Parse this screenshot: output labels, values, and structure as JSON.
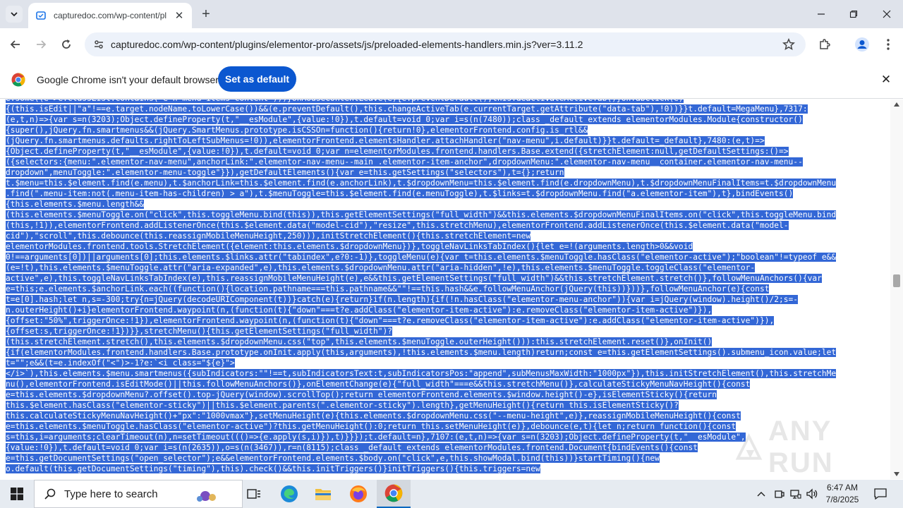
{
  "browser": {
    "tab_title": "capturedoc.com/wp-content/pl",
    "url": "capturedoc.com/wp-content/plugins/elementor-pro/assets/js/preloaded-elements-handlers.min.js?ver=3.11.2",
    "infobar_text": "Google Chrome isn't your default browser",
    "set_default_label": "Set as default"
  },
  "code_lines": [
    "e.some((e=>e.classList.contains(\"e-n-menu-items-content\")))}onMouseContentLeave(e){e.preventDefault(),this.deactivateActiveTab()}onTabClick(e)",
    "{(this.isEdit||\"a\"!==e.target.nodeName.toLowerCase())&&(e.preventDefault(),this.changeActiveTab(e.currentTarget.getAttribute(\"data-tab\"),!0))}}t.default=MegaMenu},7317:",
    "(e,t,n)=>{var s=n(3203);Object.defineProperty(t,\"__esModule\",{value:!0}),t.default=void 0;var i=s(n(7480));class _default extends elementorModules.Module{constructor()",
    "{super(),jQuery.fn.smartmenus&&(jQuery.SmartMenus.prototype.isCSSOn=function(){return!0},elementorFrontend.config.is_rtl&&",
    "(jQuery.fn.smartmenus.defaults.rightToLeftSubMenus=!0)),elementorFrontend.elementsHandler.attachHandler(\"nav-menu\",i.default)}}t.default=_default},7480:(e,t)=>",
    "{Object.defineProperty(t,\"__esModule\",{value:!0}),t.default=void 0;var n=elementorModules.frontend.handlers.Base.extend({stretchElement:null,getDefaultSettings:()=>",
    "({selectors:{menu:\".elementor-nav-menu\",anchorLink:\".elementor-nav-menu--main .elementor-item-anchor\",dropdownMenu:\".elementor-nav-menu__container.elementor-nav-menu--",
    "dropdown\",menuToggle:\".elementor-menu-toggle\"}}),getDefaultElements(){var e=this.getSettings(\"selectors\"),t={};return",
    "t.$menu=this.$element.find(e.menu),t.$anchorLink=this.$element.find(e.anchorLink),t.$dropdownMenu=this.$element.find(e.dropdownMenu),t.$dropdownMenuFinalItems=t.$dropdownMenu",
    ".find(\".menu-item:not(.menu-item-has-children) > a\"),t.$menuToggle=this.$element.find(e.menuToggle),t.$links=t.$dropdownMenu.find(\"a.elementor-item\"),t},bindEvents()",
    "{this.elements.$menu.length&&",
    "(this.elements.$menuToggle.on(\"click\",this.toggleMenu.bind(this)),this.getElementSettings(\"full_width\")&&this.elements.$dropdownMenuFinalItems.on(\"click\",this.toggleMenu.bind",
    "(this,!1)),elementorFrontend.addListenerOnce(this.$element.data(\"model-cid\"),\"resize\",this.stretchMenu),elementorFrontend.addListenerOnce(this.$element.data(\"model-",
    "cid\"),\"scroll\",this.debounce(this.reassignMobileMenuHeight,250))),initStretchElement(){this.stretchElement=new",
    "elementorModules.frontend.tools.StretchElement({element:this.elements.$dropdownMenu})},toggleNavLinksTabIndex(){let e=!(arguments.length>0&&void",
    "0!==arguments[0])||arguments[0];this.elements.$links.attr(\"tabindex\",e?0:-1)},toggleMenu(e){var t=this.elements.$menuToggle.hasClass(\"elementor-active\");\"boolean\"!=typeof e&&",
    "(e=!t),this.elements.$menuToggle.attr(\"aria-expanded\",e),this.elements.$dropdownMenu.attr(\"aria-hidden\",!e),this.elements.$menuToggle.toggleClass(\"elementor-",
    "active\",e),this.toggleNavLinksTabIndex(e),this.reassignMobileMenuHeight(e),e&&this.getElementSettings(\"full_width\")&&this.stretchElement.stretch()},followMenuAnchors(){var",
    "e=this;e.elements.$anchorLink.each((function(){location.pathname===this.pathname&&\"\"!==this.hash&&e.followMenuAnchor(jQuery(this))}))},followMenuAnchor(e){const",
    "t=e[0].hash;let n,s=-300;try{n=jQuery(decodeURIComponent(t))}catch(e){return}if(n.length){if(!n.hasClass(\"elementor-menu-anchor\")){var i=jQuery(window).height()/2;s=-",
    "n.outerHeight()+i}elementorFrontend.waypoint(n,(function(t){\"down\"===t?e.addClass(\"elementor-item-active\"):e.removeClass(\"elementor-item-active\")}),",
    "{offset:\"50%\",triggerOnce:!1}),elementorFrontend.waypoint(n,(function(t){\"down\"===t?e.removeClass(\"elementor-item-active\"):e.addClass(\"elementor-item-active\")}),",
    "{offset:s,triggerOnce:!1})}},stretchMenu(){this.getElementSettings(\"full_width\")?",
    "(this.stretchElement.stretch(),this.elements.$dropdownMenu.css(\"top\",this.elements.$menuToggle.outerHeight())):this.stretchElement.reset()},onInit()",
    "{if(elementorModules.frontend.handlers.Base.prototype.onInit.apply(this,arguments),!this.elements.$menu.length)return;const e=this.getElementSettings().submenu_icon.value;let",
    "t=\"\";e&&(t=e.indexOf(\"<\")>-1?e:`<i class=\"${e}\">",
    "</i>`),this.elements.$menu.smartmenus({subIndicators:\"\"!==t,subIndicatorsText:t,subIndicatorsPos:\"append\",subMenusMaxWidth:\"1000px\"}),this.initStretchElement(),this.stretchMe",
    "nu(),elementorFrontend.isEditMode()||this.followMenuAnchors()},onElementChange(e){\"full_width\"===e&&this.stretchMenu()},calculateStickyMenuNavHeight(){const",
    "e=this.elements.$dropdownMenu?.offset().top-jQuery(window).scrollTop();return elementorFrontend.elements.$window.height()-e},isElementSticky(){return",
    "this.$element.hasClass(\"elementor-sticky\")||this.$element.parents(\".elementor-sticky\").length},getMenuHeight(){return this.isElementSticky()?",
    "this.calculateStickyMenuNavHeight()+\"px\":\"1000vmax\"},setMenuHeight(e){this.elements.$dropdownMenu.css(\"--menu-height\",e)},reassignMobileMenuHeight(){const",
    "e=this.elements.$menuToggle.hasClass(\"elementor-active\")?this.getMenuHeight():0;return this.setMenuHeight(e)},debounce(e,t){let n;return function(){const",
    "s=this,i=arguments;clearTimeout(n),n=setTimeout((()=>{e.apply(s,i)}),t)}}});t.default=n},7107:(e,t,n)=>{var s=n(3203);Object.defineProperty(t,\"__esModule\",",
    "{value:!0}),t.default=void 0;var i=s(n(2635)),o=s(n(3467)),r=n(8115);class _default extends elementorModules.frontend.Document{bindEvents(){const",
    "e=this.getDocumentSettings(\"open_selector\");e&&elementorFrontend.elements.$body.on(\"click\",e,this.showModal.bind(this))}startTiming(){new",
    "o.default(this.getDocumentSettings(\"timing\"),this).check()&&this.initTriggers()}initTriggers(){this.triggers=new"
  ],
  "watermark": "ANY RUN",
  "taskbar": {
    "search_placeholder": "Type here to search",
    "time": "6:47 AM",
    "date": "7/8/2025"
  }
}
